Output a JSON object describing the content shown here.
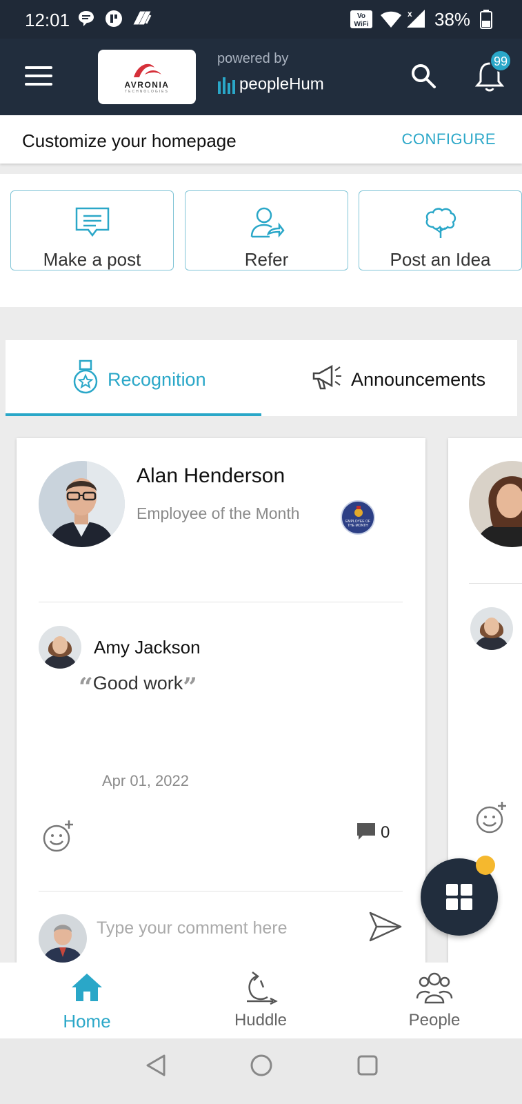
{
  "status_bar": {
    "time": "12:01",
    "battery": "38%"
  },
  "header": {
    "logo_text": "AVRONIA",
    "logo_subtext": "TECHNOLOGIES",
    "powered_by": "powered by",
    "brand": "peopleHum",
    "notification_count": "99"
  },
  "customize": {
    "label": "Customize your homepage",
    "action": "CONFIGURE"
  },
  "quick_actions": [
    {
      "label": "Make a post"
    },
    {
      "label": "Refer"
    },
    {
      "label": "Post an Idea"
    }
  ],
  "tabs": [
    {
      "label": "Recognition",
      "active": true
    },
    {
      "label": "Announcements",
      "active": false
    }
  ],
  "recognition": {
    "employee_name": "Alan Henderson",
    "award": "Employee of the Month",
    "badge_text": "EMPLOYEE OF THE MONTH",
    "given_by": "Amy Jackson",
    "message": "Good work",
    "date": "Apr 01, 2022",
    "comment_count": "0",
    "comment_placeholder": "Type your comment here"
  },
  "bottom_nav": [
    {
      "label": "Home",
      "active": true
    },
    {
      "label": "Huddle",
      "active": false
    },
    {
      "label": "People",
      "active": false
    }
  ],
  "colors": {
    "accent": "#2aa7c8",
    "header_bg": "#212d3d",
    "fab_dot": "#f5b82e"
  }
}
